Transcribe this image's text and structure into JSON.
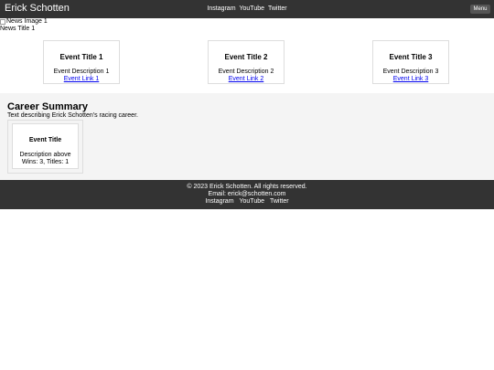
{
  "header": {
    "brand": "Erick Schotten",
    "nav": [
      "Instagram",
      "YouTube",
      "Twitter"
    ],
    "menu_label": "Menu"
  },
  "news": {
    "image_alt": "News Image 1",
    "title": "News Title 1"
  },
  "events": [
    {
      "title": "Event Title 1",
      "description": "Event Description 1",
      "link": "Event Link 1"
    },
    {
      "title": "Event Title 2",
      "description": "Event Description 2",
      "link": "Event Link 2"
    },
    {
      "title": "Event Title 3",
      "description": "Event Description 3",
      "link": "Event Link 3"
    }
  ],
  "career": {
    "title": "Career Summary",
    "text": "Text describing Erick Schotten's racing career.",
    "card": {
      "title": "Event Title",
      "description": "Description above",
      "stats": "Wins: 3, Titles: 1"
    }
  },
  "footer": {
    "copyright": "© 2023 Erick Schotten. All rights reserved.",
    "email": "Email: erick@schotten.com",
    "links": [
      "Instagram",
      "YouTube",
      "Twitter"
    ]
  }
}
